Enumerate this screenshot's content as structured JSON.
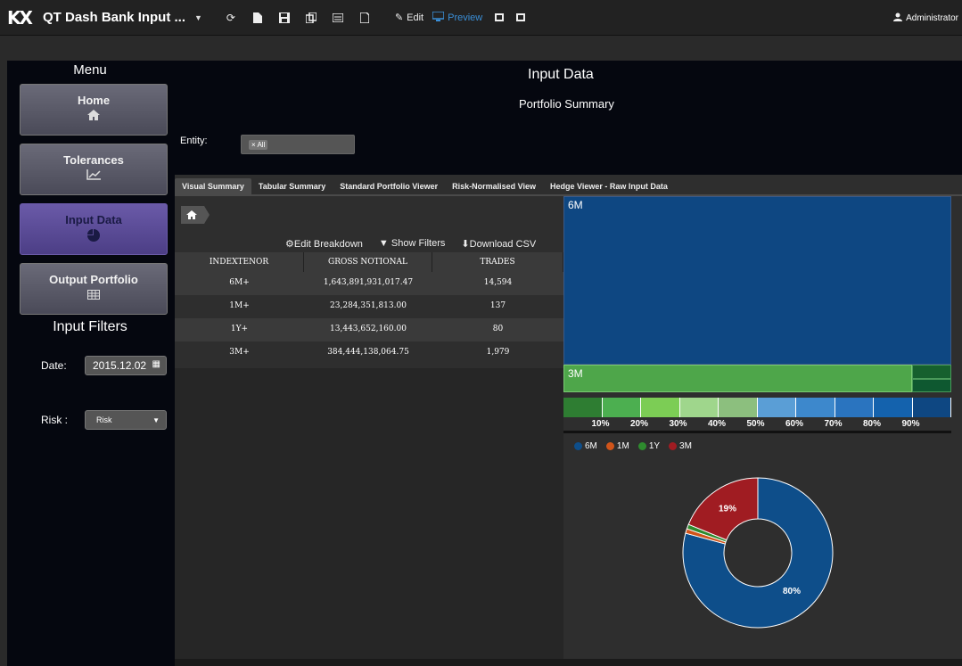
{
  "topbar": {
    "logo": "KX",
    "title": "QT Dash Bank Input ...",
    "edit_label": "Edit",
    "preview_label": "Preview",
    "user": "Administrator"
  },
  "sidebar": {
    "menu_title": "Menu",
    "items": [
      {
        "label": "Home",
        "icon": "home-icon"
      },
      {
        "label": "Tolerances",
        "icon": "chart-line-icon"
      },
      {
        "label": "Input Data",
        "icon": "pie-chart-icon"
      },
      {
        "label": "Output Portfolio",
        "icon": "table-icon"
      }
    ],
    "filters_title": "Input Filters",
    "date_label": "Date:",
    "date_value": "2015.12.02",
    "risk_label": "Risk :",
    "risk_value": "Risk"
  },
  "header": {
    "title": "Input Data",
    "subtitle": "Portfolio Summary",
    "entity_label": "Entity:",
    "entity_chip": "All"
  },
  "tabs": [
    {
      "label": "Visual Summary",
      "active": true
    },
    {
      "label": "Tabular Summary",
      "active": false
    },
    {
      "label": "Standard Portfolio Viewer",
      "active": false
    },
    {
      "label": "Risk-Normalised View",
      "active": false
    },
    {
      "label": "Hedge Viewer - Raw Input Data",
      "active": false
    }
  ],
  "grid_toolbar": {
    "edit_breakdown": "Edit Breakdown",
    "show_filters": "Show Filters",
    "download_csv": "Download CSV"
  },
  "grid": {
    "columns": [
      "INDEXTENOR",
      "GROSS NOTIONAL",
      "TRADES"
    ],
    "rows": [
      [
        "6M+",
        "1,643,891,931,017.47",
        "14,594"
      ],
      [
        "1M+",
        "23,284,351,813.00",
        "137"
      ],
      [
        "1Y+",
        "13,443,652,160.00",
        "80"
      ],
      [
        "3M+",
        "384,444,138,064.75",
        "1,979"
      ]
    ]
  },
  "treemap": {
    "labels": {
      "six_m": "6M",
      "three_m": "3M"
    },
    "colors": {
      "six_m": "#0e4782",
      "three_m": "#4ea64a",
      "one_y": "#16602e",
      "one_m": "#0e5830"
    }
  },
  "color_scale": {
    "colors": [
      "#2e7d32",
      "#4caf50",
      "#7ccd55",
      "#9fd68c",
      "#8cbf7e",
      "#5a9ed6",
      "#3d88cc",
      "#2a74bf",
      "#1462ad",
      "#0e4782"
    ],
    "ticks": [
      "10%",
      "20%",
      "30%",
      "40%",
      "50%",
      "60%",
      "70%",
      "80%",
      "90%"
    ]
  },
  "chart_data": {
    "type": "pie",
    "donut": true,
    "legend_position": "top-left",
    "series": [
      {
        "name": "6M",
        "value": 80,
        "color": "#0e4e8a"
      },
      {
        "name": "1M",
        "value": 1,
        "color": "#d0541a"
      },
      {
        "name": "1Y",
        "value": 1,
        "color": "#2e8b2e"
      },
      {
        "name": "3M",
        "value": 19,
        "color": "#a01c22"
      }
    ],
    "data_labels": [
      "80%",
      "19%"
    ]
  }
}
